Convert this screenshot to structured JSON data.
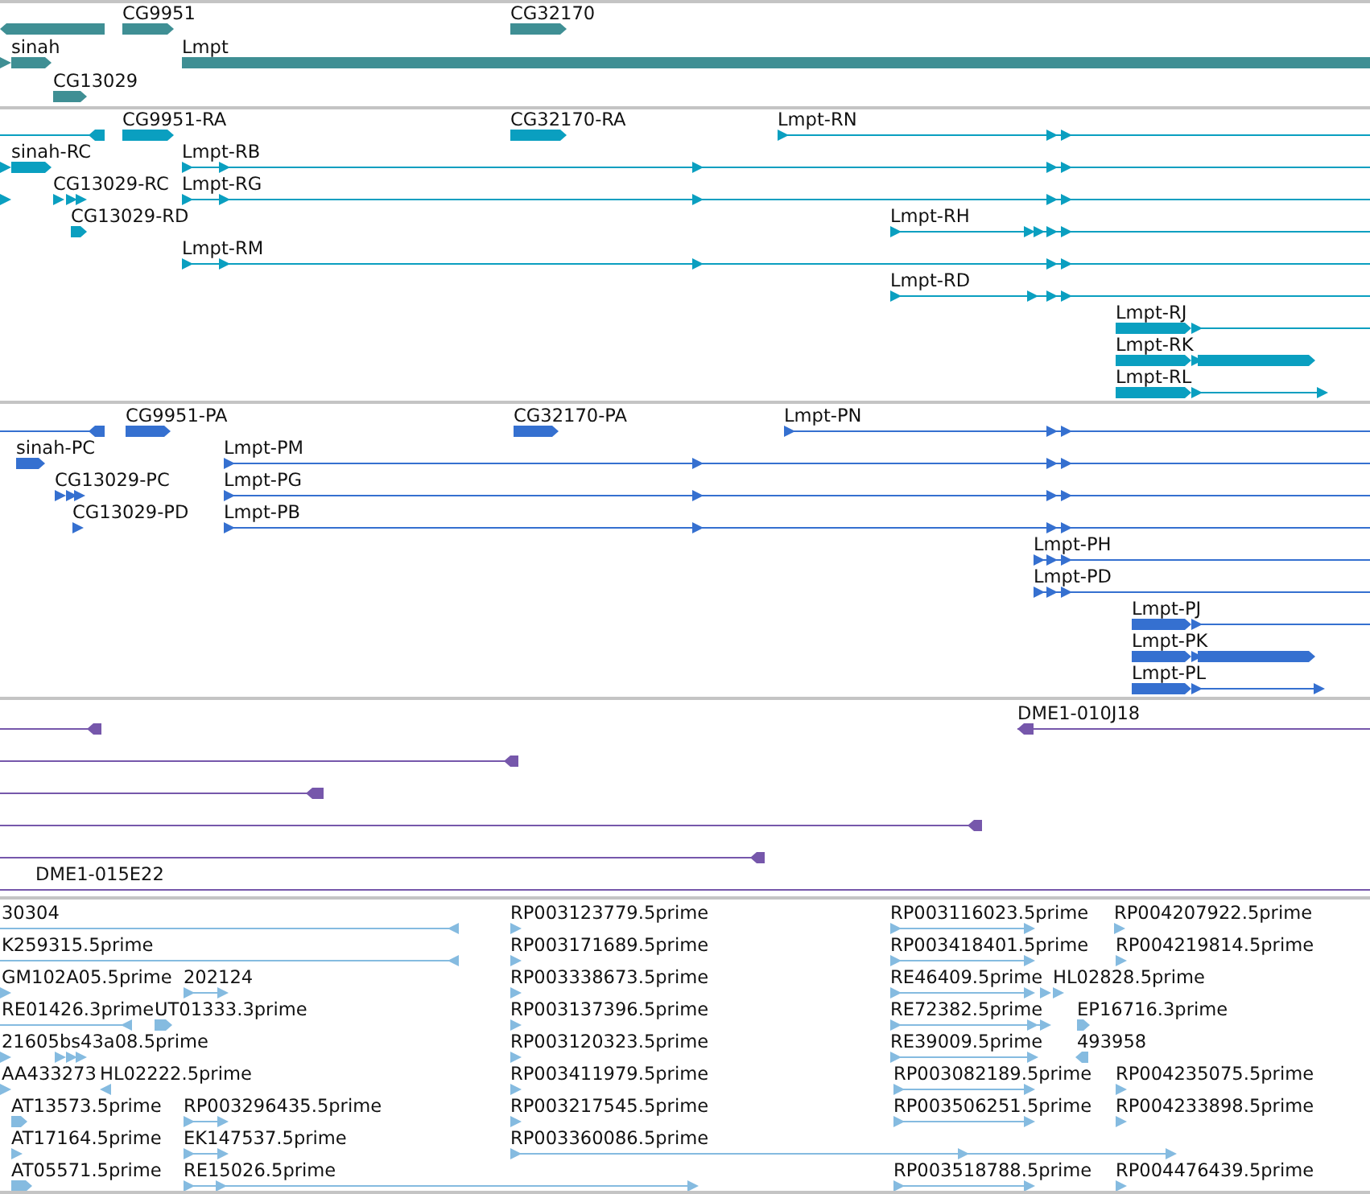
{
  "tracks": [
    {
      "color": "#3f8f94",
      "features": [
        {
          "reverse": true
        },
        {
          "label": "CG9951",
          "reverse": false
        },
        {
          "label": "CG32170",
          "reverse": false
        },
        {
          "reverse": false
        },
        {
          "label": "sinah",
          "reverse": false
        },
        {
          "label": "Lmpt",
          "reverse": false
        },
        {
          "label": "CG13029",
          "reverse": false
        }
      ]
    },
    {
      "color": "#0a9fc0",
      "features": [
        {
          "reverse": true
        },
        {
          "label": "CG9951-RA",
          "reverse": false
        },
        {
          "label": "CG32170-RA",
          "reverse": false
        },
        {
          "label": "Lmpt-RN",
          "reverse": false
        },
        {
          "reverse": false
        },
        {
          "label": "sinah-RC",
          "reverse": false
        },
        {
          "label": "Lmpt-RB",
          "reverse": false
        },
        {
          "reverse": false
        },
        {
          "label": "CG13029-RC",
          "reverse": false
        },
        {
          "label": "Lmpt-RG",
          "reverse": false
        },
        {
          "label": "CG13029-RD",
          "reverse": false
        },
        {
          "label": "Lmpt-RH",
          "reverse": false
        },
        {
          "label": "Lmpt-RM",
          "reverse": false
        },
        {
          "label": "Lmpt-RD",
          "reverse": false
        },
        {
          "label": "Lmpt-RJ",
          "reverse": false
        },
        {
          "label": "Lmpt-RK",
          "reverse": false
        },
        {
          "label": "Lmpt-RL",
          "reverse": false
        }
      ]
    },
    {
      "color": "#3570d0",
      "features": [
        {
          "reverse": true
        },
        {
          "label": "CG9951-PA",
          "reverse": false
        },
        {
          "label": "CG32170-PA",
          "reverse": false
        },
        {
          "label": "Lmpt-PN",
          "reverse": false
        },
        {
          "label": "sinah-PC",
          "reverse": false
        },
        {
          "label": "Lmpt-PM",
          "reverse": false
        },
        {
          "label": "CG13029-PC",
          "reverse": false
        },
        {
          "label": "Lmpt-PG",
          "reverse": false
        },
        {
          "label": "CG13029-PD",
          "reverse": false
        },
        {
          "label": "Lmpt-PB",
          "reverse": false
        },
        {
          "label": "Lmpt-PH",
          "reverse": false
        },
        {
          "label": "Lmpt-PD",
          "reverse": false
        },
        {
          "label": "Lmpt-PJ",
          "reverse": false
        },
        {
          "label": "Lmpt-PK",
          "reverse": false
        },
        {
          "label": "Lmpt-PL",
          "reverse": false
        }
      ]
    },
    {
      "color": "#7657ab",
      "features": [
        {
          "reverse": true
        },
        {
          "label": "DME1-010J18",
          "reverse": true
        },
        {
          "reverse": true
        },
        {
          "reverse": true
        },
        {
          "reverse": true
        },
        {
          "reverse": true
        },
        {
          "label": "DME1-015E22"
        }
      ]
    },
    {
      "color": "#85bbe0",
      "features": [
        {
          "label": "30304",
          "reverse": true
        },
        {
          "label": "RP003123779.5prime",
          "reverse": false
        },
        {
          "label": "RP003116023.5prime",
          "reverse": false
        },
        {
          "label": "RP004207922.5prime",
          "reverse": false
        },
        {
          "label": "K259315.5prime",
          "reverse": true
        },
        {
          "label": "RP003171689.5prime",
          "reverse": false
        },
        {
          "label": "RP003418401.5prime",
          "reverse": false
        },
        {
          "label": "RP004219814.5prime",
          "reverse": false
        },
        {
          "label": "GM102A05.5prime",
          "reverse": false
        },
        {
          "label": "202124",
          "reverse": false
        },
        {
          "label": "RP003338673.5prime",
          "reverse": false
        },
        {
          "label": "RE46409.5prime",
          "reverse": false
        },
        {
          "label": "HL02828.5prime",
          "reverse": false
        },
        {
          "label": "RE01426.3prime",
          "reverse": true
        },
        {
          "label": "UT01333.3prime",
          "reverse": false
        },
        {
          "label": "RP003137396.5prime",
          "reverse": false
        },
        {
          "label": "RE72382.5prime",
          "reverse": false
        },
        {
          "label": "EP16716.3prime",
          "reverse": false
        },
        {
          "label": "21605",
          "reverse": false
        },
        {
          "label": "bs43a08.5prime",
          "reverse": false
        },
        {
          "label": "RP003120323.5prime",
          "reverse": false
        },
        {
          "label": "RE39009.5prime",
          "reverse": false
        },
        {
          "label": "493958",
          "reverse": true
        },
        {
          "label": "AA433273",
          "reverse": false
        },
        {
          "label": "HL02222.5prime",
          "reverse": true
        },
        {
          "label": "RP003411979.5prime",
          "reverse": false
        },
        {
          "label": "RP003082189.5prime",
          "reverse": false
        },
        {
          "label": "RP004235075.5prime",
          "reverse": false
        },
        {
          "label": "AT13573.5prime",
          "reverse": false
        },
        {
          "label": "RP003296435.5prime",
          "reverse": false
        },
        {
          "label": "RP003217545.5prime",
          "reverse": false
        },
        {
          "label": "RP003506251.5prime",
          "reverse": false
        },
        {
          "label": "RP004233898.5prime",
          "reverse": false
        },
        {
          "label": "AT17164.5prime",
          "reverse": false
        },
        {
          "label": "EK147537.5prime",
          "reverse": false
        },
        {
          "label": "RP003360086.5prime",
          "reverse": false
        },
        {
          "label": "AT05571.5prime",
          "reverse": false
        },
        {
          "label": "RE15026.5prime",
          "reverse": false
        },
        {
          "label": "RP003518788.5prime",
          "reverse": false
        },
        {
          "label": "RP004476439.5prime",
          "reverse": false
        }
      ]
    }
  ]
}
